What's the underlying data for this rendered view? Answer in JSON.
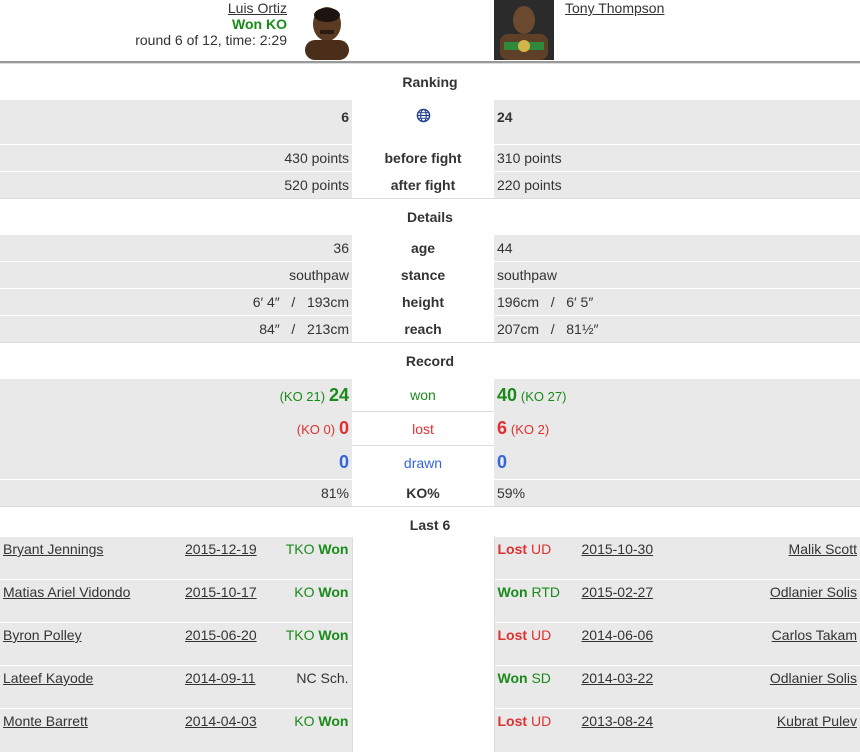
{
  "fighter1": {
    "name": "Luis Ortiz",
    "result": "Won KO",
    "meta": "round 6 of 12, time: 2:29"
  },
  "fighter2": {
    "name": "Tony Thompson"
  },
  "sections": {
    "ranking": "Ranking",
    "details": "Details",
    "record": "Record",
    "last6": "Last 6"
  },
  "ranking": {
    "left_rank": "6",
    "right_rank": "24",
    "icon": "globe-icon",
    "before_label": "before fight",
    "after_label": "after fight",
    "left_before": "430 points",
    "right_before": "310 points",
    "left_after": "520 points",
    "right_after": "220 points"
  },
  "details": {
    "age_label": "age",
    "left_age": "36",
    "right_age": "44",
    "stance_label": "stance",
    "left_stance": "southpaw",
    "right_stance": "southpaw",
    "height_label": "height",
    "left_height": "6′ 4″   /   193cm",
    "right_height": "196cm   /   6′ 5″",
    "reach_label": "reach",
    "left_reach": "84″   /   213cm",
    "right_reach": "207cm   /   81½″"
  },
  "record": {
    "won_label": "won",
    "lost_label": "lost",
    "drawn_label": "drawn",
    "ko_label": "KO%",
    "left_won_ko": "(KO 21)",
    "left_won": "24",
    "right_won": "40",
    "right_won_ko": "(KO 27)",
    "left_lost_ko": "(KO 0)",
    "left_lost": "0",
    "right_lost": "6",
    "right_lost_ko": "(KO 2)",
    "left_drawn": "0",
    "right_drawn": "0",
    "left_ko": "81%",
    "right_ko": "59%"
  },
  "last6": [
    {
      "l_opp": "Bryant Jennings",
      "l_date": "2015-12-19",
      "l_method": "TKO",
      "l_result": "Won",
      "r_result": "Lost",
      "r_method": "UD",
      "r_date": "2015-10-30",
      "r_opp": "Malik Scott"
    },
    {
      "l_opp": "Matias Ariel Vidondo",
      "l_date": "2015-10-17",
      "l_method": "KO",
      "l_result": "Won",
      "r_result": "Won",
      "r_method": "RTD",
      "r_date": "2015-02-27",
      "r_opp": "Odlanier Solis"
    },
    {
      "l_opp": "Byron Polley",
      "l_date": "2015-06-20",
      "l_method": "TKO",
      "l_result": "Won",
      "r_result": "Lost",
      "r_method": "UD",
      "r_date": "2014-06-06",
      "r_opp": "Carlos Takam"
    },
    {
      "l_opp": "Lateef Kayode",
      "l_date": "2014-09-11",
      "l_method": "NC Sch.",
      "l_result": "",
      "r_result": "Won",
      "r_method": "SD",
      "r_date": "2014-03-22",
      "r_opp": "Odlanier Solis"
    },
    {
      "l_opp": "Monte Barrett",
      "l_date": "2014-04-03",
      "l_method": "KO",
      "l_result": "Won",
      "r_result": "Lost",
      "r_method": "UD",
      "r_date": "2013-08-24",
      "r_opp": "Kubrat Pulev"
    }
  ],
  "colors": {
    "won": "#1a8a1a",
    "lost": "#e03030",
    "drawn": "#3366dd"
  }
}
